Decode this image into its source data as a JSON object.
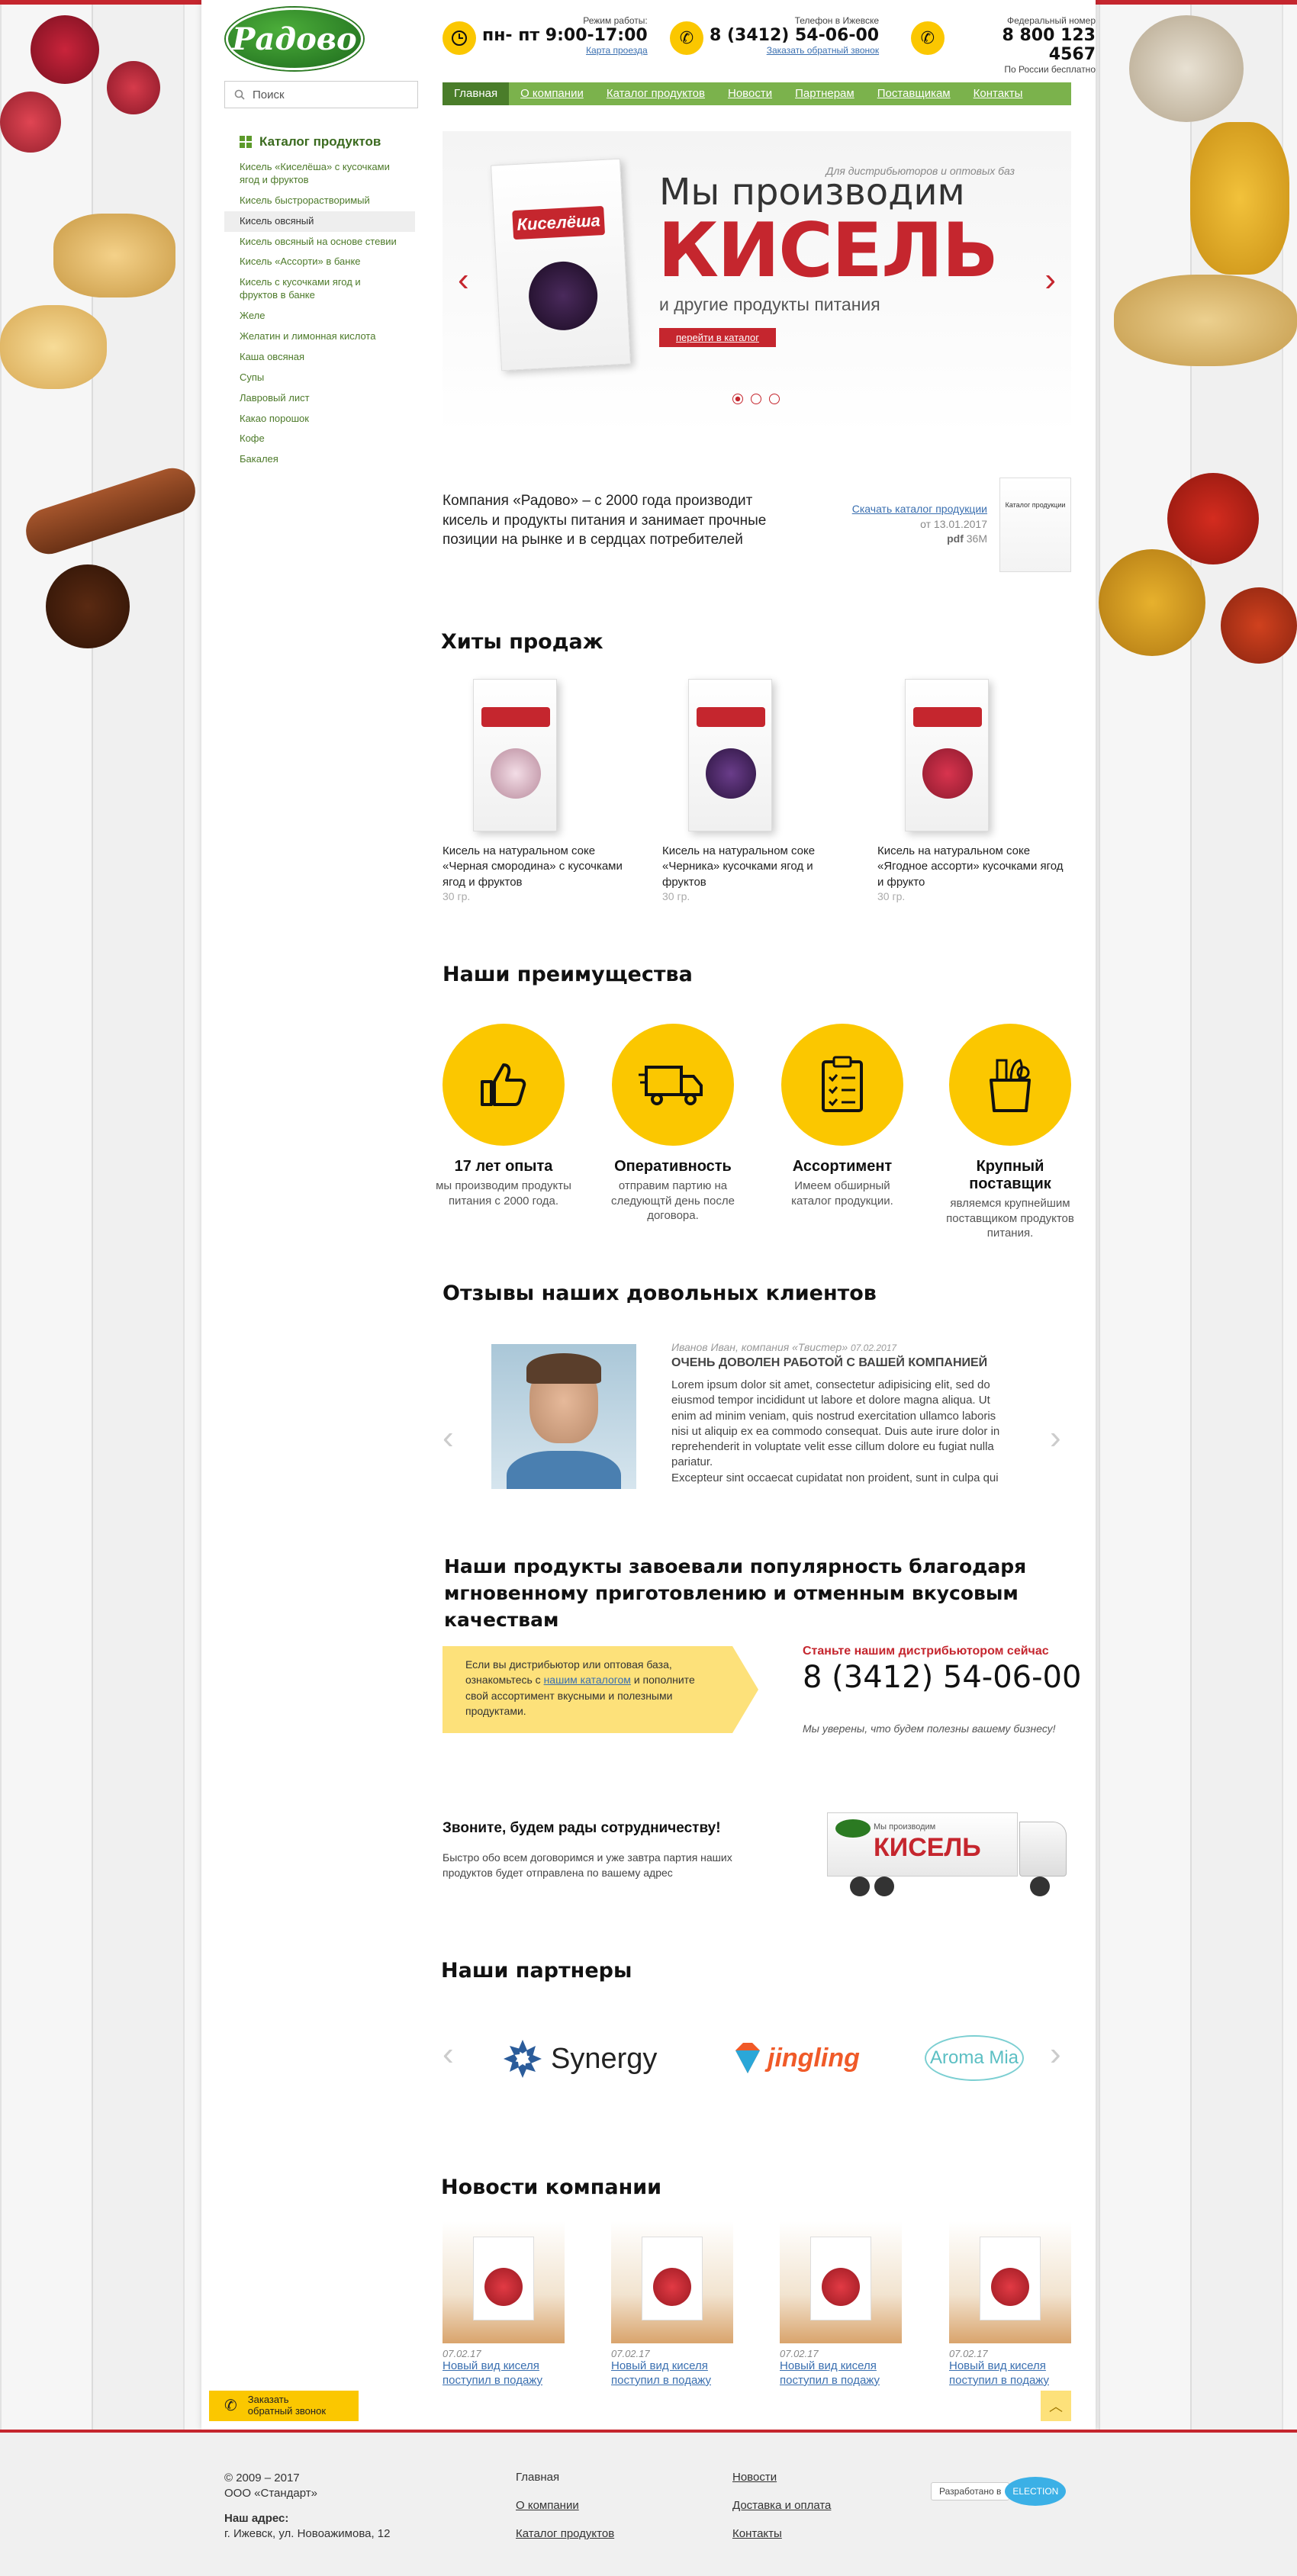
{
  "brand": {
    "logo": "Радово"
  },
  "search": {
    "placeholder": "Поиск"
  },
  "header": {
    "hours_label": "Режим работы:",
    "hours": "пн- пт 9:00-17:00",
    "hours_link": "Карта проезда",
    "phone_label": "Телефон в Ижевске",
    "phone": "8 (3412) 54-06-00",
    "phone_link": "Заказать обратный звонок",
    "fed_label": "Федеральный номер",
    "fed_phone": "8 800 123 4567",
    "fed_note": "По России бесплатно"
  },
  "nav": [
    "Главная",
    "О компании",
    "Каталог продуктов",
    "Новости",
    "Партнерам",
    "Поставщикам",
    "Контакты"
  ],
  "catalog": {
    "title": "Каталог продуктов",
    "items": [
      "Кисель «Киселёша» с кусочками ягод и фруктов",
      "Кисель быстрорастворимый",
      "Кисель овсяный",
      "Кисель овсяный на основе стевии",
      "Кисель «Ассорти» в банке",
      "Кисель с кусочками ягод и фруктов в банке",
      "Желе",
      "Желатин и лимонная кислота",
      "Каша овсяная",
      "Супы",
      "Лавровый лист",
      "Какао порошок",
      "Кофе",
      "Бакалея"
    ]
  },
  "slider": {
    "tagline": "Для дистрибьюторов и оптовых баз",
    "line1": "Мы производим",
    "line2": "КИСЕЛЬ",
    "line3": "и другие продукты питания",
    "button": "перейти в каталог",
    "box_brand": "Киселёша"
  },
  "intro": {
    "text": "Компания «Радово» – с 2000 года производит кисель и продукты питания и занимает прочные позиции на рынке и в сердцах потребителей",
    "download": "Скачать каталог продукции",
    "date": "от 13.01.2017",
    "format": "pdf",
    "size": "36M",
    "thumb_text": "Каталог продукции"
  },
  "hits": {
    "title": "Хиты продаж",
    "items": [
      {
        "name": "Кисель на натуральном соке «Черная смородина» с кусочками ягод и фруктов",
        "weight": "30 гр."
      },
      {
        "name": "Кисель на натуральном соке «Черника» кусочками ягод и фруктов",
        "weight": "30 гр."
      },
      {
        "name": "Кисель на натуральном соке «Ягодное ассорти» кусочками ягод и фрукто",
        "weight": "30 гр."
      }
    ]
  },
  "advantages": {
    "title": "Наши преимущества",
    "items": [
      {
        "title": "17 лет опыта",
        "text": "мы производим продукты питания с 2000 года.",
        "icon": "thumbs-up-icon"
      },
      {
        "title": "Оперативность",
        "text": "отправим партию на следующтй день после договора.",
        "icon": "truck-icon"
      },
      {
        "title": "Ассортимент",
        "text": "Имеем обширный каталог продукции.",
        "icon": "checklist-icon"
      },
      {
        "title": "Крупный поставщик",
        "text": "являемся крупнейшим поставщиком продуктов питания.",
        "icon": "grocery-bag-icon"
      }
    ]
  },
  "reviews": {
    "title": "Отзывы наших довольных клиентов",
    "author": "Иванов Иван, компания «Твистер»",
    "date": "07.02.2017",
    "heading": "ОЧЕНЬ ДОВОЛЕН РАБОТОЙ С ВАШЕЙ КОМПАНИЕЙ",
    "text": "Lorem ipsum dolor sit amet, consectetur adipisicing elit, sed do eiusmod tempor incididunt ut labore et dolore magna aliqua. Ut enim ad minim veniam, quis nostrud exercitation ullamco laboris nisi ut aliquip ex ea commodo consequat. Duis aute irure dolor in reprehenderit in voluptate velit esse cillum dolore eu fugiat nulla pariatur.",
    "text2": "Excepteur sint occaecat cupidatat non proident, sunt in culpa qui"
  },
  "popularity": {
    "title": "Наши продукты завоевали популярность благодаря мгновенному приготовлению и отменным вкусовым качествам",
    "note_pre": "Если вы дистрибьютор или оптовая база, ознакомьтесь с ",
    "note_link": "нашим каталогом",
    "note_post": " и пополните свой ассортимент вкусными и полезными продуктами.",
    "cta": "Станьте нашим дистрибьютором сейчас",
    "phone": "8 (3412) 54-06-00",
    "sub": "Мы уверены, что будем полезны вашему бизнесу!"
  },
  "call": {
    "title": "Звоните, будем рады сотрудничеству!",
    "text": "Быстро обо всем договоримся и уже завтра партия наших продуктов будет отправлена по вашему адрес",
    "truck_small": "Мы производим",
    "truck_big": "КИСЕЛЬ"
  },
  "partners": {
    "title": "Наши партнеры",
    "items": [
      "Synergy",
      "jingling",
      "Aroma Mia"
    ]
  },
  "news": {
    "title": "Новости компании",
    "items": [
      {
        "date": "07.02.17",
        "text": "Новый вид киселя поступил в подажу"
      },
      {
        "date": "07.02.17",
        "text": "Новый вид киселя поступил в подажу"
      },
      {
        "date": "07.02.17",
        "text": "Новый вид киселя поступил в подажу"
      },
      {
        "date": "07.02.17",
        "text": "Новый вид киселя поступил в подажу"
      }
    ]
  },
  "callback": {
    "text": "Заказать обратный звонок"
  },
  "footer": {
    "copy": "© 2009 – 2017",
    "org": "ООО «Стандарт»",
    "addr_label": "Наш адрес:",
    "addr": "г. Ижевск, ул. Новоажимова, 12",
    "col1": [
      "Главная",
      "О компании",
      "Каталог продуктов"
    ],
    "col2": [
      "Новости",
      "Доставка и оплата",
      "Контакты"
    ],
    "dev_label": "Разработано в",
    "dev_name": "ELECTION"
  }
}
